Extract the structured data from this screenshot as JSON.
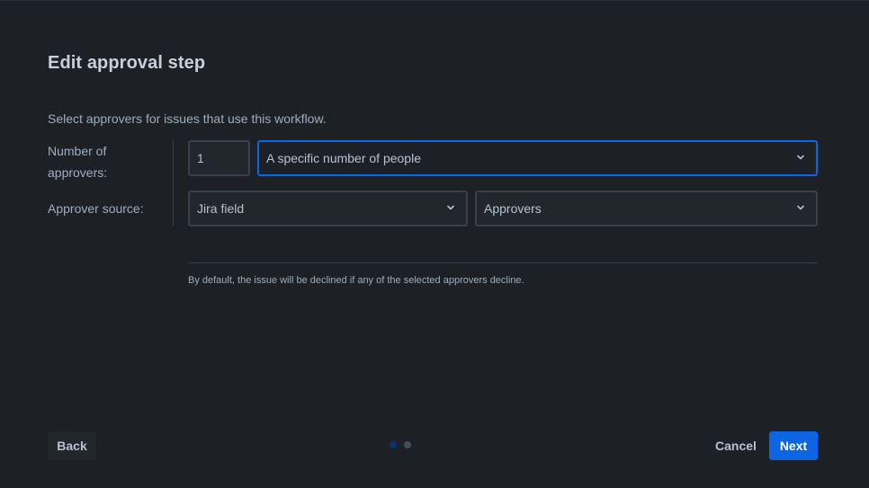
{
  "dialog": {
    "title": "Edit approval step",
    "intro": "Select approvers for issues that use this workflow."
  },
  "form": {
    "number_of_approvers": {
      "label": "Number of approvers:",
      "value": "1",
      "mode_select": "A specific number of people"
    },
    "approver_source": {
      "label": "Approver source:",
      "source_type": "Jira field",
      "field_name": "Approvers"
    }
  },
  "note": "By default, the issue will be declined if any of the selected approvers decline.",
  "footer": {
    "back_label": "Back",
    "cancel_label": "Cancel",
    "next_label": "Next",
    "step_current": 1,
    "step_total": 2
  },
  "colors": {
    "background": "#1d2125",
    "primary": "#0c66e4",
    "field_border": "#38414a",
    "text": "#b6c2cf"
  },
  "icons": {
    "dropdown": "chevron-down-icon"
  }
}
